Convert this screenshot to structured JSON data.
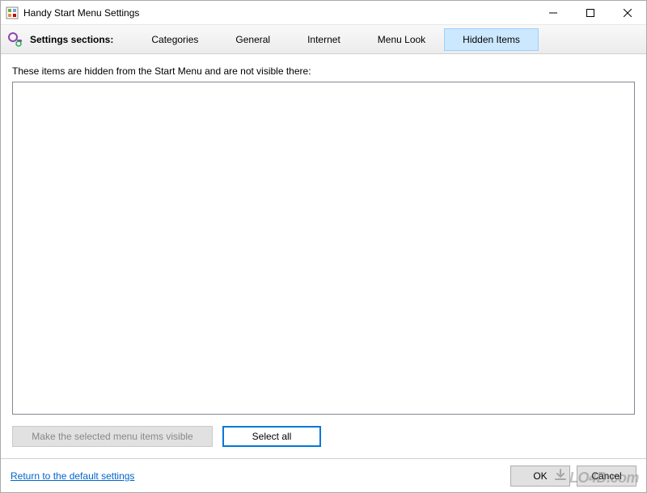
{
  "window": {
    "title": "Handy Start Menu Settings"
  },
  "toolbar": {
    "sections_label": "Settings sections:",
    "tabs": [
      {
        "label": "Categories",
        "active": false
      },
      {
        "label": "General",
        "active": false
      },
      {
        "label": "Internet",
        "active": false
      },
      {
        "label": "Menu Look",
        "active": false
      },
      {
        "label": "Hidden Items",
        "active": true
      }
    ]
  },
  "content": {
    "description": "These items are hidden from the Start Menu and are not visible there:",
    "make_visible_label": "Make the selected menu items visible",
    "select_all_label": "Select all"
  },
  "footer": {
    "reset_link": "Return to the default settings",
    "ok_label": "OK",
    "cancel_label": "Cancel"
  },
  "watermark": "LO4D.com"
}
